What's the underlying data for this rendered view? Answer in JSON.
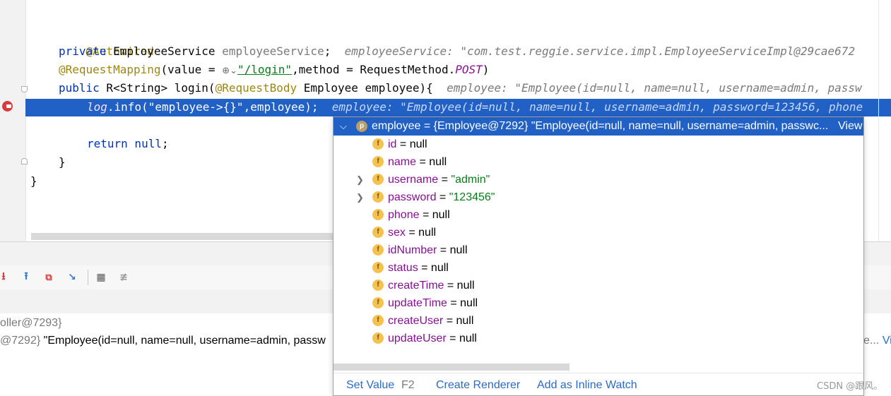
{
  "editor": {
    "lines": {
      "l1": "@Autowired",
      "l2_kw": "private",
      "l2_type": " EmployeeService ",
      "l2_field": "employeeService",
      "l2_semi": ";",
      "l2_hint": "employeeService: \"com.test.reggie.service.impl.EmployeeServiceImpl@29cae672",
      "l3_ann": "@RequestMapping",
      "l3_a": "(value = ",
      "l3_globe": "⊕⌄",
      "l3_str": "\"/login\"",
      "l3_b": ",method = RequestMethod.",
      "l3_post": "POST",
      "l3_c": ")",
      "l4_kw": "public",
      "l4_a": " R<String> login(",
      "l4_ann": "@RequestBody",
      "l4_b": " Employee employee){",
      "l4_hint": "employee: \"Employee(id=null, name=null, username=admin, passw",
      "l5_log": "log",
      "l5_a": ".info(",
      "l5_str": "\"employee->{}\"",
      "l5_b": ",employee);",
      "l5_hint": "employee: \"Employee(id=null, name=null, username=admin, password=123456, phone",
      "l6_kw": "return",
      "l6_null": " null",
      "l6_semi": ";",
      "l7": "}",
      "l8": "}"
    }
  },
  "variables": {
    "row1": "oller@7293}",
    "row2_obj": "@7292}",
    "row2_text": " \"Employee(id=null, name=null, username=admin, passw",
    "row2_tail": "e... ",
    "row2_view": "Vie"
  },
  "popup": {
    "header": {
      "badge": "p",
      "text": "employee = {Employee@7292} \"Employee(id=null, name=null, username=admin, passwc...",
      "view": "View"
    },
    "fields": [
      {
        "name": "id",
        "value": "null",
        "string": false,
        "expandable": false
      },
      {
        "name": "name",
        "value": "null",
        "string": false,
        "expandable": false
      },
      {
        "name": "username",
        "value": "\"admin\"",
        "string": true,
        "expandable": true
      },
      {
        "name": "password",
        "value": "\"123456\"",
        "string": true,
        "expandable": true
      },
      {
        "name": "phone",
        "value": "null",
        "string": false,
        "expandable": false
      },
      {
        "name": "sex",
        "value": "null",
        "string": false,
        "expandable": false
      },
      {
        "name": "idNumber",
        "value": "null",
        "string": false,
        "expandable": false
      },
      {
        "name": "status",
        "value": "null",
        "string": false,
        "expandable": false
      },
      {
        "name": "createTime",
        "value": "null",
        "string": false,
        "expandable": false
      },
      {
        "name": "updateTime",
        "value": "null",
        "string": false,
        "expandable": false
      },
      {
        "name": "createUser",
        "value": "null",
        "string": false,
        "expandable": false
      },
      {
        "name": "updateUser",
        "value": "null",
        "string": false,
        "expandable": false
      }
    ],
    "field_badge": "f",
    "footer": {
      "set_value": "Set Value",
      "set_value_key": "F2",
      "create_renderer": "Create Renderer",
      "add_inline_watch": "Add as Inline Watch"
    }
  },
  "watermark": "CSDN @跟风。",
  "colors": {
    "selection": "#2160c4",
    "keyword": "#0033b3",
    "annotation": "#9e880d",
    "field": "#871094",
    "string": "#067d17",
    "link": "#2a6bc7"
  },
  "icons": [
    "breakpoint-icon",
    "step-into-icon",
    "step-out-icon",
    "drop-frame-icon",
    "run-to-cursor-icon",
    "evaluate-icon",
    "trace-icon",
    "field-icon",
    "property-icon",
    "expand-arrow-icon"
  ]
}
